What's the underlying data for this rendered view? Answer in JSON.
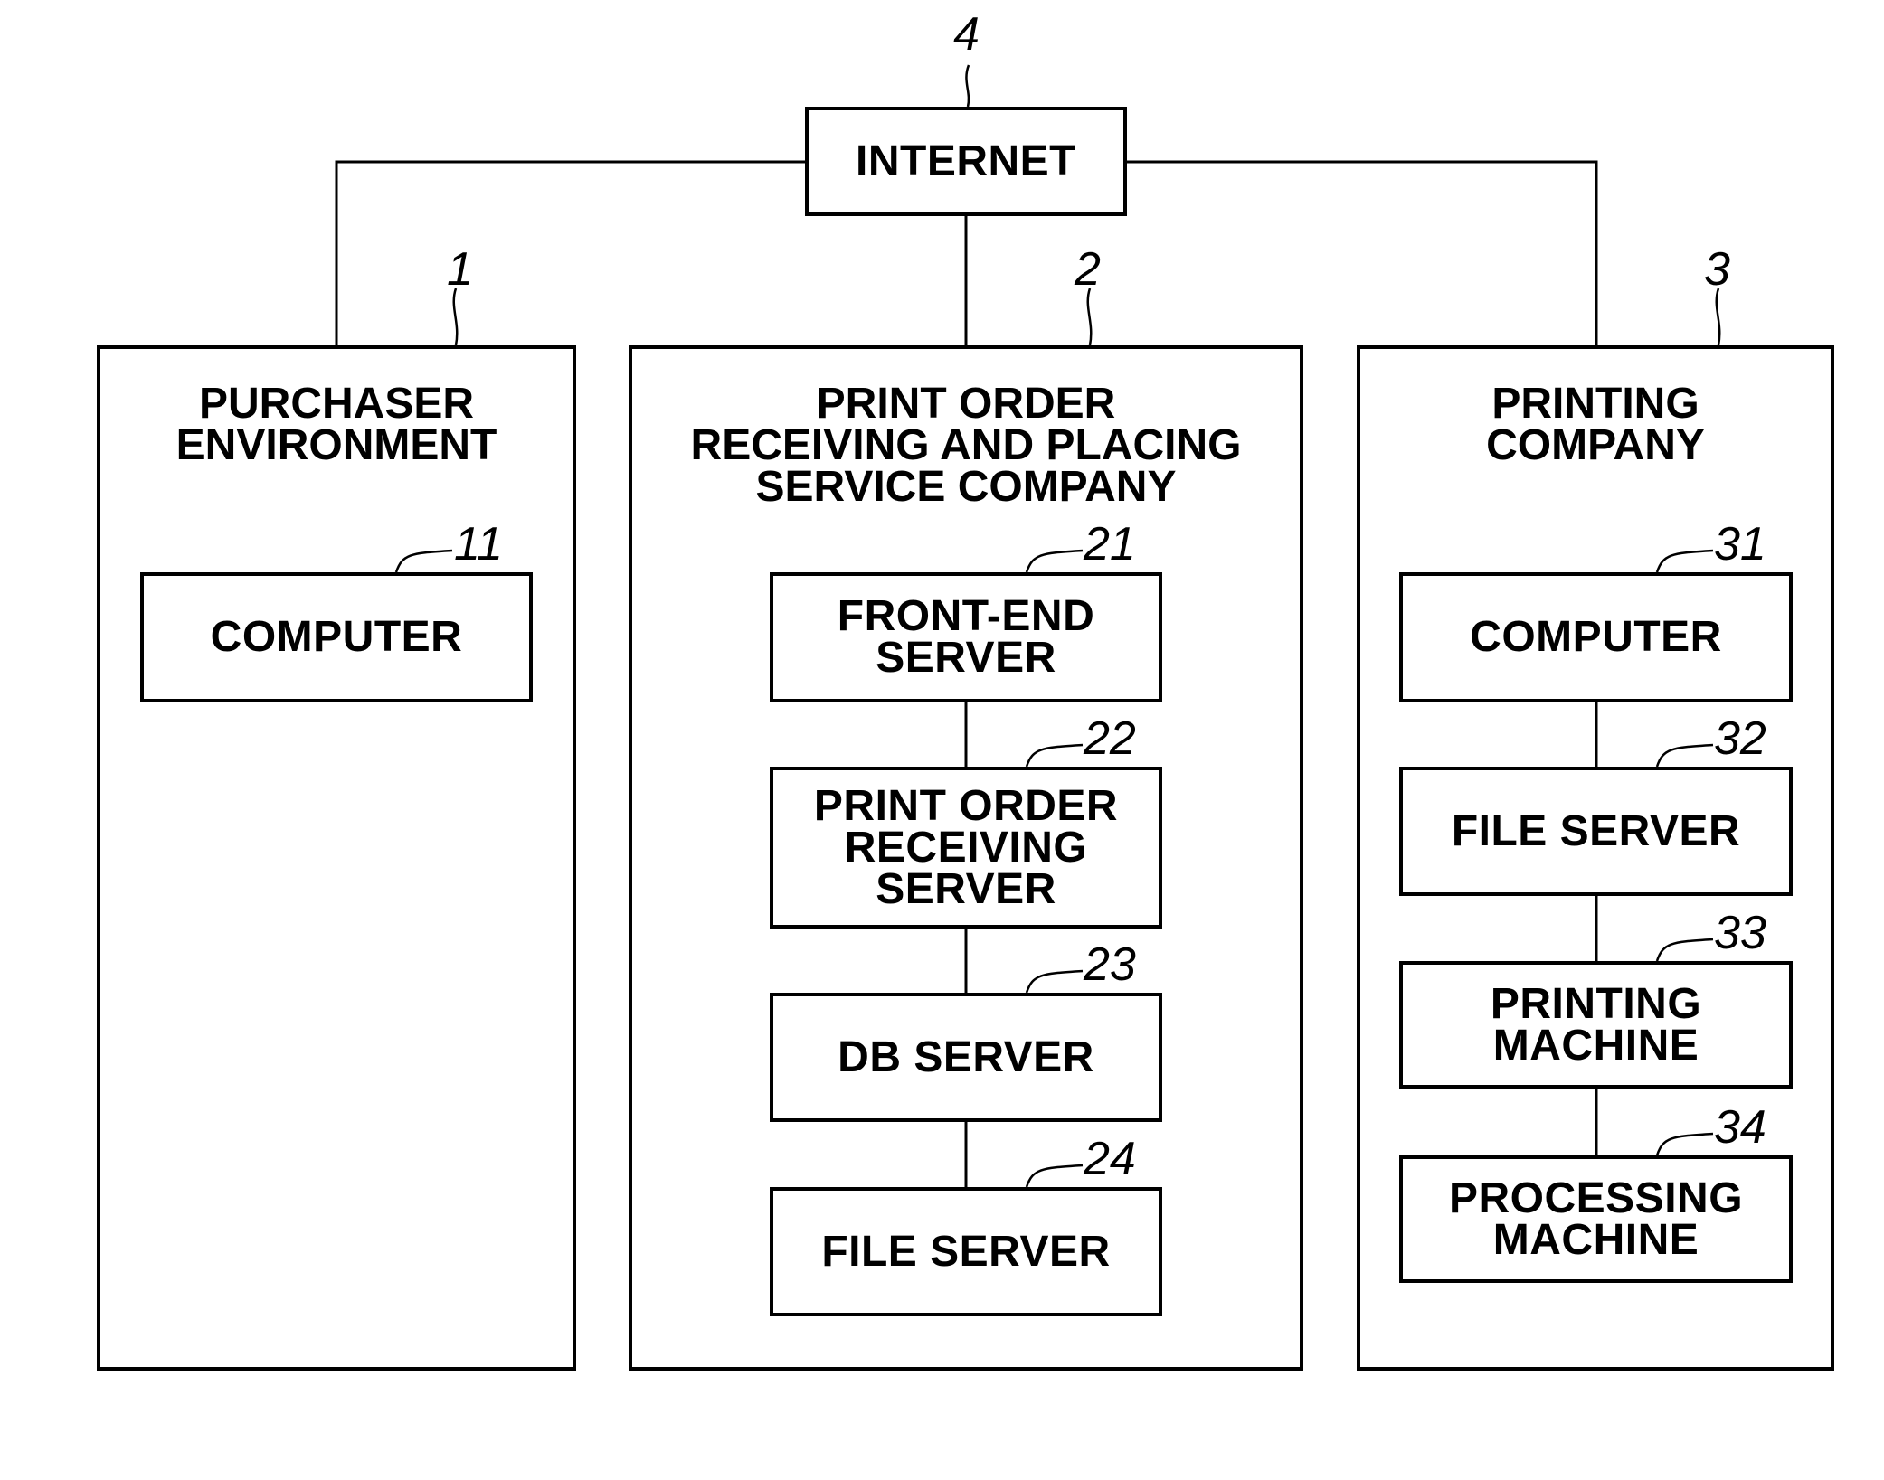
{
  "diagram": {
    "internet": {
      "label": "INTERNET",
      "ref": "4"
    },
    "purchaser": {
      "title": "PURCHASER\nENVIRONMENT",
      "ref": "1",
      "nodes": [
        {
          "label": "COMPUTER",
          "ref": "11"
        }
      ]
    },
    "service_company": {
      "title": "PRINT ORDER\nRECEIVING AND PLACING\nSERVICE COMPANY",
      "ref": "2",
      "nodes": [
        {
          "label": "FRONT-END\nSERVER",
          "ref": "21"
        },
        {
          "label": "PRINT ORDER\nRECEIVING\nSERVER",
          "ref": "22"
        },
        {
          "label": "DB SERVER",
          "ref": "23"
        },
        {
          "label": "FILE SERVER",
          "ref": "24"
        }
      ]
    },
    "printing_company": {
      "title": "PRINTING\nCOMPANY",
      "ref": "3",
      "nodes": [
        {
          "label": "COMPUTER",
          "ref": "31"
        },
        {
          "label": "FILE SERVER",
          "ref": "32"
        },
        {
          "label": "PRINTING\nMACHINE",
          "ref": "33"
        },
        {
          "label": "PROCESSING\nMACHINE",
          "ref": "34"
        }
      ]
    }
  }
}
